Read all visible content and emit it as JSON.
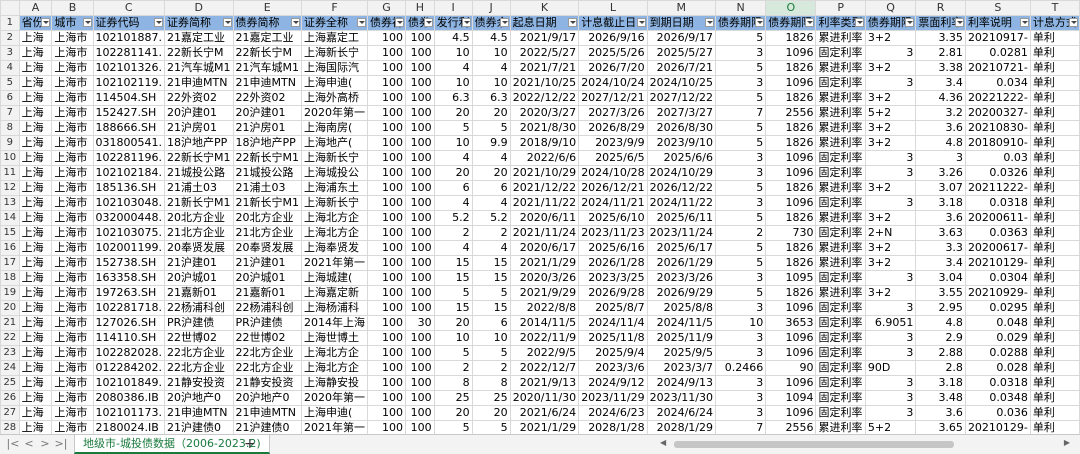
{
  "columns": [
    "A",
    "B",
    "C",
    "D",
    "E",
    "F",
    "G",
    "H",
    "I",
    "J",
    "K",
    "L",
    "M",
    "N",
    "O",
    "P",
    "Q",
    "R",
    "S",
    "T"
  ],
  "selected_column": "O",
  "headers": [
    "省份",
    "城市",
    "证券代码",
    "证券简称",
    "债券简称",
    "证券全称",
    "债券初",
    "债券",
    "发行利",
    "债券余",
    "起息日期",
    "计息截止日",
    "到期日期",
    "债券期限",
    "债券期限",
    "利率类型",
    "债券期限",
    "票面利率",
    "利率说明",
    "计息方式"
  ],
  "rows": [
    [
      "上海",
      "上海市",
      "102101887.",
      "21嘉定工业",
      "21嘉定工业",
      "上海嘉定工",
      "100",
      "100",
      "4.5",
      "4.5",
      "2021/9/17",
      "2026/9/16",
      "2026/9/17",
      "5",
      "1826",
      "累进利率",
      "3+2",
      "3.35",
      "20210917-",
      "单利"
    ],
    [
      "上海",
      "上海市",
      "102281141.",
      "22新长宁M",
      "22新长宁M",
      "上海新长宁",
      "100",
      "100",
      "10",
      "10",
      "2022/5/27",
      "2025/5/26",
      "2025/5/27",
      "3",
      "1096",
      "固定利率",
      "3",
      "2.81",
      "0.0281",
      "单利"
    ],
    [
      "上海",
      "上海市",
      "102101326.",
      "21汽车城M1",
      "21汽车城M1",
      "上海国际汽",
      "100",
      "100",
      "4",
      "4",
      "2021/7/21",
      "2026/7/20",
      "2026/7/21",
      "5",
      "1826",
      "累进利率",
      "3+2",
      "3.38",
      "20210721-",
      "单利"
    ],
    [
      "上海",
      "上海市",
      "102102119.",
      "21申迪MTN",
      "21申迪MTN",
      "上海申迪(",
      "100",
      "100",
      "10",
      "10",
      "2021/10/25",
      "2024/10/24",
      "2024/10/25",
      "3",
      "1096",
      "固定利率",
      "3",
      "3.4",
      "0.034",
      "单利"
    ],
    [
      "上海",
      "上海市",
      "114504.SH",
      "22外资02",
      "22外资02",
      "上海外高桥",
      "100",
      "100",
      "6.3",
      "6.3",
      "2022/12/22",
      "2027/12/21",
      "2027/12/22",
      "5",
      "1826",
      "累进利率",
      "3+2",
      "4.36",
      "20221222-",
      "单利"
    ],
    [
      "上海",
      "上海市",
      "152427.SH",
      "20沪建01",
      "20沪建01",
      "2020年第一",
      "100",
      "100",
      "20",
      "20",
      "2020/3/27",
      "2027/3/26",
      "2027/3/27",
      "7",
      "2556",
      "累进利率",
      "5+2",
      "3.2",
      "20200327-",
      "单利"
    ],
    [
      "上海",
      "上海市",
      "188666.SH",
      "21沪房01",
      "21沪房01",
      "上海南房(",
      "100",
      "100",
      "5",
      "5",
      "2021/8/30",
      "2026/8/29",
      "2026/8/30",
      "5",
      "1826",
      "累进利率",
      "3+2",
      "3.6",
      "20210830-",
      "单利"
    ],
    [
      "上海",
      "上海市",
      "031800541.",
      "18沪地产PP",
      "18沪地产PP",
      "上海地产(",
      "100",
      "100",
      "10",
      "9.9",
      "2018/9/10",
      "2023/9/9",
      "2023/9/10",
      "5",
      "1826",
      "累进利率",
      "3+2",
      "4.8",
      "20180910-",
      "单利"
    ],
    [
      "上海",
      "上海市",
      "102281196.",
      "22新长宁M1",
      "22新长宁M1",
      "上海新长宁",
      "100",
      "100",
      "4",
      "4",
      "2022/6/6",
      "2025/6/5",
      "2025/6/6",
      "3",
      "1096",
      "固定利率",
      "3",
      "3",
      "0.03",
      "单利"
    ],
    [
      "上海",
      "上海市",
      "102102184.",
      "21城投公路",
      "21城投公路",
      "上海城投公",
      "100",
      "100",
      "20",
      "20",
      "2021/10/29",
      "2024/10/28",
      "2024/10/29",
      "3",
      "1096",
      "固定利率",
      "3",
      "3.26",
      "0.0326",
      "单利"
    ],
    [
      "上海",
      "上海市",
      "185136.SH",
      "21浦土03",
      "21浦土03",
      "上海浦东土",
      "100",
      "100",
      "6",
      "6",
      "2021/12/22",
      "2026/12/21",
      "2026/12/22",
      "5",
      "1826",
      "累进利率",
      "3+2",
      "3.07",
      "20211222-",
      "单利"
    ],
    [
      "上海",
      "上海市",
      "102103048.",
      "21新长宁M1",
      "21新长宁M1",
      "上海新长宁",
      "100",
      "100",
      "4",
      "4",
      "2021/11/22",
      "2024/11/21",
      "2024/11/22",
      "3",
      "1096",
      "固定利率",
      "3",
      "3.18",
      "0.0318",
      "单利"
    ],
    [
      "上海",
      "上海市",
      "032000448.",
      "20北方企业",
      "20北方企业",
      "上海北方企",
      "100",
      "100",
      "5.2",
      "5.2",
      "2020/6/11",
      "2025/6/10",
      "2025/6/11",
      "5",
      "1826",
      "累进利率",
      "3+2",
      "3.6",
      "20200611-",
      "单利"
    ],
    [
      "上海",
      "上海市",
      "102103075.",
      "21北方企业",
      "21北方企业",
      "上海北方企",
      "100",
      "100",
      "2",
      "2",
      "2021/11/24",
      "2023/11/23",
      "2023/11/24",
      "2",
      "730",
      "固定利率",
      "2+N",
      "3.63",
      "0.0363",
      "单利"
    ],
    [
      "上海",
      "上海市",
      "102001199.",
      "20奉贤发展",
      "20奉贤发展",
      "上海奉贤发",
      "100",
      "100",
      "4",
      "4",
      "2020/6/17",
      "2025/6/16",
      "2025/6/17",
      "5",
      "1826",
      "累进利率",
      "3+2",
      "3.3",
      "20200617-",
      "单利"
    ],
    [
      "上海",
      "上海市",
      "152738.SH",
      "21沪建01",
      "21沪建01",
      "2021年第一",
      "100",
      "100",
      "15",
      "15",
      "2021/1/29",
      "2026/1/28",
      "2026/1/29",
      "5",
      "1826",
      "累进利率",
      "3+2",
      "3.4",
      "20210129-",
      "单利"
    ],
    [
      "上海",
      "上海市",
      "163358.SH",
      "20沪城01",
      "20沪城01",
      "上海城建(",
      "100",
      "100",
      "15",
      "15",
      "2020/3/26",
      "2023/3/25",
      "2023/3/26",
      "3",
      "1095",
      "固定利率",
      "3",
      "3.04",
      "0.0304",
      "单利"
    ],
    [
      "上海",
      "上海市",
      "197263.SH",
      "21嘉新01",
      "21嘉新01",
      "上海嘉定新",
      "100",
      "100",
      "5",
      "5",
      "2021/9/29",
      "2026/9/28",
      "2026/9/29",
      "5",
      "1826",
      "累进利率",
      "3+2",
      "3.55",
      "20210929-",
      "单利"
    ],
    [
      "上海",
      "上海市",
      "102281718.",
      "22杨浦科创",
      "22杨浦科创",
      "上海杨浦科",
      "100",
      "100",
      "15",
      "15",
      "2022/8/8",
      "2025/8/7",
      "2025/8/8",
      "3",
      "1096",
      "固定利率",
      "3",
      "2.95",
      "0.0295",
      "单利"
    ],
    [
      "上海",
      "上海市",
      "127026.SH",
      "PR沪建债",
      "PR沪建债",
      "2014年上海",
      "100",
      "30",
      "20",
      "6",
      "2014/11/5",
      "2024/11/4",
      "2024/11/5",
      "10",
      "3653",
      "固定利率",
      "6.9051",
      "4.8",
      "0.048",
      "单利"
    ],
    [
      "上海",
      "上海市",
      "114110.SH",
      "22世博02",
      "22世博02",
      "上海世博土",
      "100",
      "100",
      "10",
      "10",
      "2022/11/9",
      "2025/11/8",
      "2025/11/9",
      "3",
      "1096",
      "固定利率",
      "3",
      "2.9",
      "0.029",
      "单利"
    ],
    [
      "上海",
      "上海市",
      "102282028.",
      "22北方企业",
      "22北方企业",
      "上海北方企",
      "100",
      "100",
      "5",
      "5",
      "2022/9/5",
      "2025/9/4",
      "2025/9/5",
      "3",
      "1096",
      "固定利率",
      "3",
      "2.88",
      "0.0288",
      "单利"
    ],
    [
      "上海",
      "上海市",
      "012284202.",
      "22北方企业",
      "22北方企业",
      "上海北方企",
      "100",
      "100",
      "2",
      "2",
      "2022/12/7",
      "2023/3/6",
      "2023/3/7",
      "0.2466",
      "90",
      "固定利率",
      "90D",
      "2.8",
      "0.028",
      "单利"
    ],
    [
      "上海",
      "上海市",
      "102101849.",
      "21静安投资",
      "21静安投资",
      "上海静安投",
      "100",
      "100",
      "8",
      "8",
      "2021/9/13",
      "2024/9/12",
      "2024/9/13",
      "3",
      "1096",
      "固定利率",
      "3",
      "3.18",
      "0.0318",
      "单利"
    ],
    [
      "上海",
      "上海市",
      "2080386.IB",
      "20沪地产0",
      "20沪地产0",
      "2020年第一",
      "100",
      "100",
      "25",
      "25",
      "2020/11/30",
      "2023/11/29",
      "2023/11/30",
      "3",
      "1094",
      "固定利率",
      "3",
      "3.48",
      "0.0348",
      "单利"
    ],
    [
      "上海",
      "上海市",
      "102101173.",
      "21申迪MTN",
      "21申迪MTN",
      "上海申迪(",
      "100",
      "100",
      "20",
      "20",
      "2021/6/24",
      "2024/6/23",
      "2024/6/24",
      "3",
      "1096",
      "固定利率",
      "3",
      "3.6",
      "0.036",
      "单利"
    ],
    [
      "上海",
      "上海市",
      "2180024.IB",
      "21沪建债0",
      "21沪建债0",
      "2021年第一",
      "100",
      "100",
      "5",
      "5",
      "2021/1/29",
      "2028/1/28",
      "2028/1/29",
      "7",
      "2556",
      "累进利率",
      "5+2",
      "3.65",
      "20210129-",
      "单利"
    ],
    [
      "上海",
      "上海市",
      "163389.SH",
      "20浦房01",
      "20浦房01",
      "上海市浦东",
      "100",
      "100",
      "16",
      "16",
      "2020/4/7",
      "2025/4/6",
      "2025/4/7",
      "5",
      "1826",
      "累进利率",
      "3+2",
      "3",
      "20200407-",
      "单利"
    ]
  ],
  "sheet_tab": "地级市-城投债数据（2006-2023.2)",
  "add_tab_label": "+",
  "nav_labels": [
    "|<",
    "<",
    ">",
    ">|"
  ],
  "colors": {
    "header_fill": "#8db4e2",
    "selected_col": "#1a7a3c",
    "grid": "#d9d9d9"
  }
}
